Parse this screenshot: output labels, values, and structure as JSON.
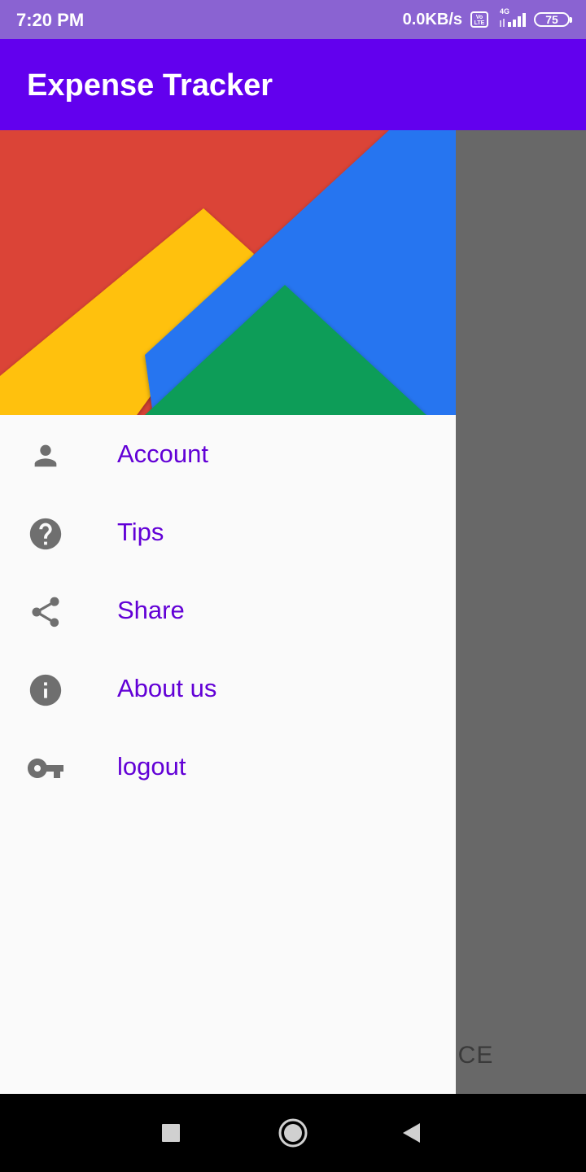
{
  "status_bar": {
    "time": "7:20 PM",
    "network_speed": "0.0KB/s",
    "volte_label": "Vo LTE",
    "network_type": "4G",
    "battery_level": "75"
  },
  "app_bar": {
    "title": "Expense Tracker"
  },
  "drawer": {
    "header_colors": [
      "#db4437",
      "#ffc107",
      "#2575f0",
      "#0f9d58"
    ],
    "items": [
      {
        "label": "Account",
        "icon": "person-icon"
      },
      {
        "label": "Tips",
        "icon": "help-circle-icon"
      },
      {
        "label": "Share",
        "icon": "share-icon"
      },
      {
        "label": "About us",
        "icon": "info-icon"
      },
      {
        "label": "logout",
        "icon": "key-icon"
      }
    ],
    "label_color": "#6200d6",
    "icon_color": "#6f6f6f"
  },
  "background_content": {
    "partial_text": "NCE"
  },
  "colors": {
    "status_bar": "#8a63d2",
    "app_bar": "#6200ee",
    "scrim": "#686868",
    "drawer_bg": "#fafafa"
  }
}
